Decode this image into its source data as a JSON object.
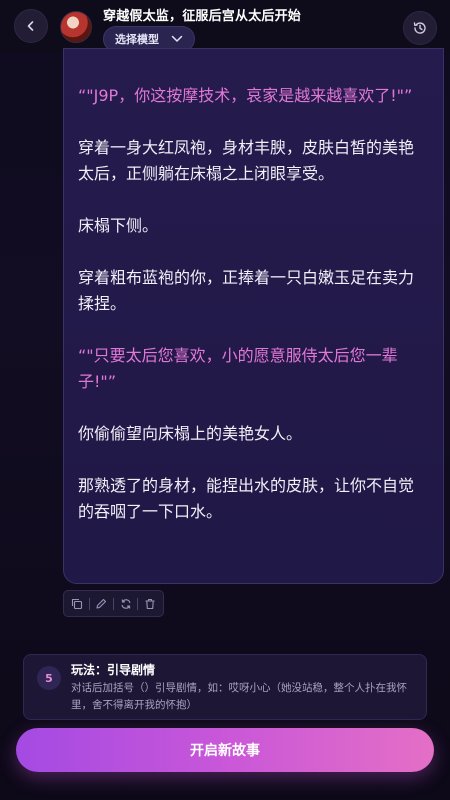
{
  "header": {
    "title": "穿越假太监，征服后宫从太后开始",
    "model_label": "选择模型",
    "back_icon": "chevron-left-icon",
    "history_icon": "history-icon"
  },
  "message": {
    "paragraphs": [
      {
        "text": "“\"J9P，你这按摩技术，哀家是越来越喜欢了!\"”",
        "style": "pink"
      },
      {
        "text": "穿着一身大红凤袍，身材丰腴，皮肤白皙的美艳太后，正侧躺在床榻之上闭眼享受。",
        "style": "white"
      },
      {
        "text": "床榻下侧。",
        "style": "white"
      },
      {
        "text": "穿着粗布蓝袍的你，正捧着一只白嫩玉足在卖力揉捏。",
        "style": "white"
      },
      {
        "text": "“\"只要太后您喜欢，小的愿意服侍太后您一辈子!\"”",
        "style": "pink"
      },
      {
        "text": "你偷偷望向床榻上的美艳女人。",
        "style": "white"
      },
      {
        "text": "那熟透了的身材，能捏出水的皮肤，让你不自觉的吞咽了一下口水。",
        "style": "white"
      }
    ]
  },
  "actions": [
    "copy-icon",
    "edit-icon",
    "refresh-icon",
    "trash-icon"
  ],
  "tip": {
    "badge": "5",
    "title": "玩法：引导剧情",
    "description": "对话后加括号（）引导剧情，如：哎呀小心（她没站稳，整个人扑在我怀里，舍不得离开我的怀抱）"
  },
  "start_button": "开启新故事",
  "colors": {
    "accent_pink": "#e178d6",
    "button_start": "#a44ae3",
    "button_end": "#e46fc6"
  }
}
